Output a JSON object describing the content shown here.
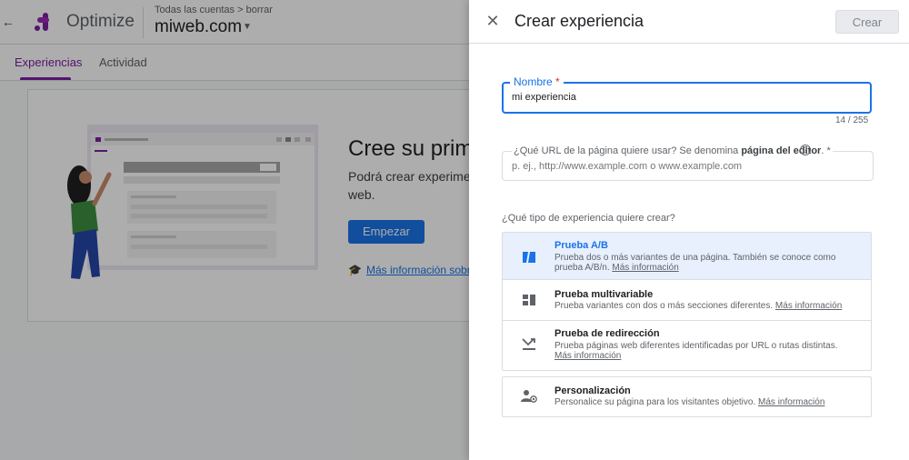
{
  "app": {
    "product_name": "Optimize",
    "breadcrumb": "Todas las cuentas > borrar",
    "account_name": "miweb.com",
    "tabs": [
      {
        "label": "Experiencias",
        "active": true
      },
      {
        "label": "Actividad",
        "active": false
      }
    ],
    "hero": {
      "title": "Cree su prime",
      "text": "Podrá crear experiment su sitio web.",
      "start_button": "Empezar",
      "learn_link": "Más información sobre"
    }
  },
  "panel": {
    "title": "Crear experiencia",
    "create_button": "Crear",
    "name_field": {
      "label": "Nombre",
      "required_mark": "*",
      "value": "mi experiencia",
      "counter": "14 / 255"
    },
    "url_field": {
      "label_prefix": "¿Qué URL de la página quiere usar? Se denomina ",
      "label_bold": "página del editor",
      "label_suffix": ". *",
      "placeholder": "p. ej., http://www.example.com o www.example.com"
    },
    "type_question": "¿Qué tipo de experiencia quiere crear?",
    "options": [
      {
        "title": "Prueba A/B",
        "description": "Prueba dos o más variantes de una página. También se conoce como prueba A/B/n.",
        "link": "Más información",
        "selected": true,
        "icon": "ab-test-icon"
      },
      {
        "title": "Prueba multivariable",
        "description": "Prueba variantes con dos o más secciones diferentes.",
        "link": "Más información",
        "selected": false,
        "icon": "multivariate-icon"
      },
      {
        "title": "Prueba de redirección",
        "description": "Prueba páginas web diferentes identificadas por URL o rutas distintas.",
        "link": "Más información",
        "selected": false,
        "icon": "redirect-icon"
      },
      {
        "title": "Personalización",
        "description": "Personalice su página para los visitantes objetivo.",
        "link": "Más información",
        "selected": false,
        "icon": "personalization-icon"
      }
    ]
  },
  "colors": {
    "accent": "#1a73e8",
    "brand": "#7b1fa2",
    "selected_bg": "#e8f0fe"
  }
}
